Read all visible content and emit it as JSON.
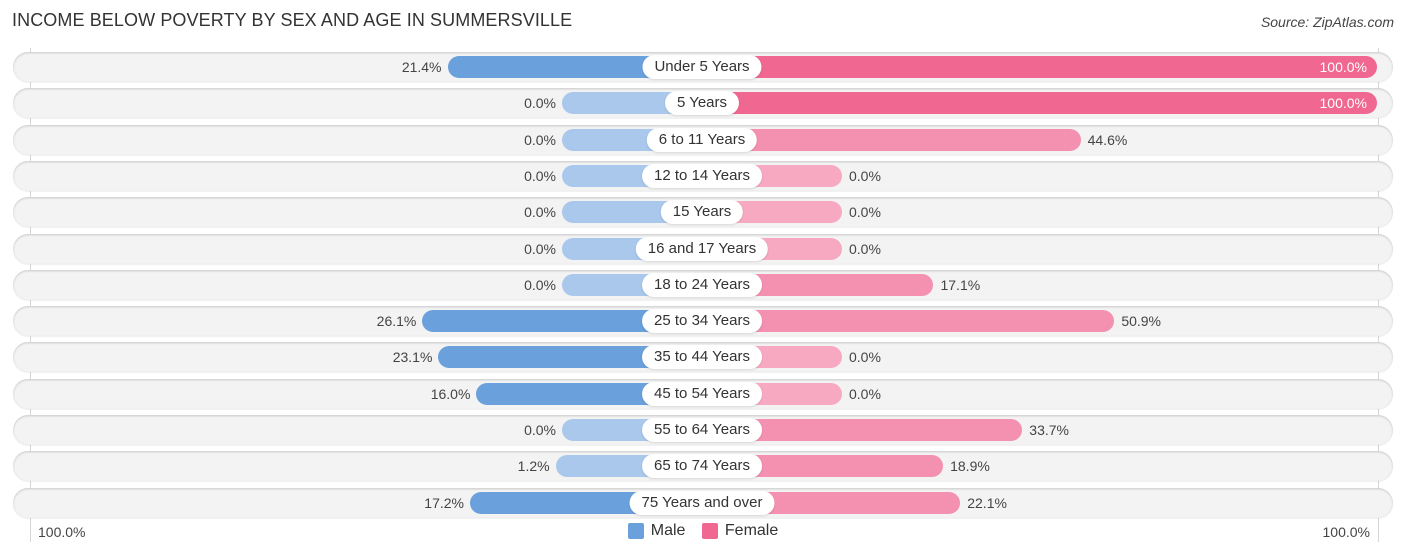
{
  "chart_data": {
    "type": "bar",
    "orientation": "horizontal-diverging",
    "title": "INCOME BELOW POVERTY BY SEX AND AGE IN SUMMERSVILLE",
    "source": "Source: ZipAtlas.com",
    "categories": [
      "Under 5 Years",
      "5 Years",
      "6 to 11 Years",
      "12 to 14 Years",
      "15 Years",
      "16 and 17 Years",
      "18 to 24 Years",
      "25 to 34 Years",
      "35 to 44 Years",
      "45 to 54 Years",
      "55 to 64 Years",
      "65 to 74 Years",
      "75 Years and over"
    ],
    "series": [
      {
        "name": "Male",
        "color": "#6aa0dc",
        "values": [
          21.4,
          0.0,
          0.0,
          0.0,
          0.0,
          0.0,
          0.0,
          26.1,
          23.1,
          16.0,
          0.0,
          1.2,
          17.2
        ]
      },
      {
        "name": "Female",
        "color": "#f06792",
        "values": [
          100.0,
          100.0,
          44.6,
          0.0,
          0.0,
          0.0,
          17.1,
          50.9,
          0.0,
          0.0,
          33.7,
          18.9,
          22.1
        ]
      }
    ],
    "value_labels": {
      "Male": [
        "21.4%",
        "0.0%",
        "0.0%",
        "0.0%",
        "0.0%",
        "0.0%",
        "0.0%",
        "26.1%",
        "23.1%",
        "16.0%",
        "0.0%",
        "1.2%",
        "17.2%"
      ],
      "Female": [
        "100.0%",
        "100.0%",
        "44.6%",
        "0.0%",
        "0.0%",
        "0.0%",
        "17.1%",
        "50.9%",
        "0.0%",
        "0.0%",
        "33.7%",
        "18.9%",
        "22.1%"
      ]
    },
    "xlim": [
      0,
      100
    ],
    "axis_labels": {
      "left": "100.0%",
      "right": "100.0%"
    },
    "legend": {
      "position": "bottom-center",
      "items": [
        "Male",
        "Female"
      ]
    },
    "colors": {
      "male": "#6aa0dc",
      "male_zero": "#a9c8ec",
      "female": "#f06792",
      "female_light": "#f490b0",
      "female_zero": "#f7a9c2"
    },
    "xlabel": "",
    "ylabel": "",
    "grid": true
  }
}
